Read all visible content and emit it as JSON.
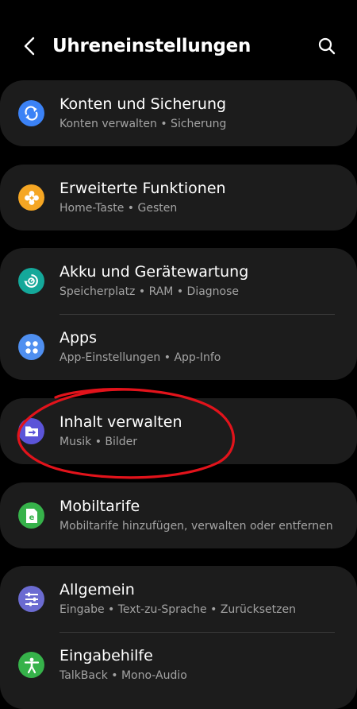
{
  "header": {
    "title": "Uhreneinstellungen",
    "back_icon": "chevron-left-icon",
    "search_icon": "search-icon"
  },
  "items": [
    {
      "label": "Konten und Sicherung",
      "sub": "Konten verwalten • Sicherung",
      "icon": "sync-icon",
      "color": "#3b82f6"
    },
    {
      "label": "Erweiterte Funktionen",
      "sub": "Home-Taste • Gesten",
      "icon": "gear-plus-icon",
      "color": "#f5a623"
    },
    {
      "label": "Akku und Gerätewartung",
      "sub": "Speicherplatz • RAM • Diagnose",
      "icon": "device-care-icon",
      "color": "#14a89a"
    },
    {
      "label": "Apps",
      "sub": "App-Einstellungen • App-Info",
      "icon": "apps-grid-icon",
      "color": "#4f8ff0"
    },
    {
      "label": "Inhalt verwalten",
      "sub": "Musik • Bilder",
      "icon": "content-transfer-icon",
      "color": "#5b54d8"
    },
    {
      "label": "Mobiltarife",
      "sub": "Mobiltarife hinzufügen, verwalten oder entfernen",
      "icon": "esim-icon",
      "color": "#36b24a"
    },
    {
      "label": "Allgemein",
      "sub": "Eingabe • Text-zu-Sprache • Zurücksetzen",
      "icon": "sliders-icon",
      "color": "#6b6bd1"
    },
    {
      "label": "Eingabehilfe",
      "sub": "TalkBack • Mono-Audio",
      "icon": "accessibility-icon",
      "color": "#36b24a"
    }
  ],
  "colors": {
    "background": "#000000",
    "card": "#1c1c1c",
    "subtext": "#a3a3a3",
    "annotation": "#e2131b"
  }
}
